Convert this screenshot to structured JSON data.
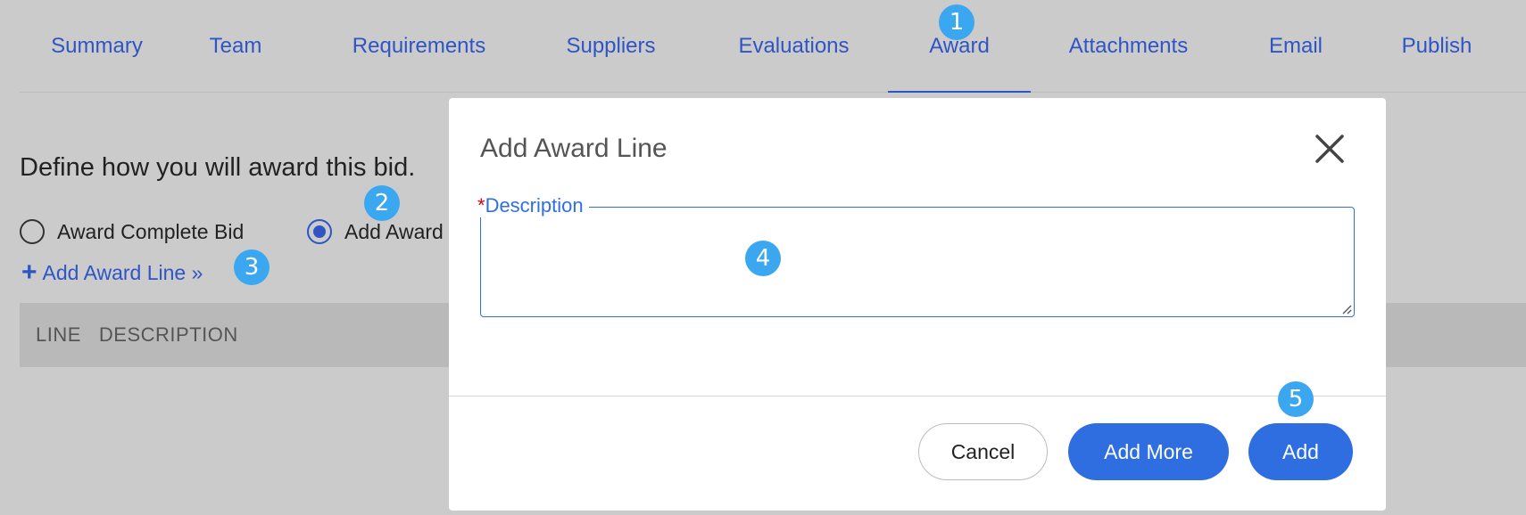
{
  "tabs": [
    {
      "label": "Summary"
    },
    {
      "label": "Team"
    },
    {
      "label": "Requirements"
    },
    {
      "label": "Suppliers"
    },
    {
      "label": "Evaluations"
    },
    {
      "label": "Award",
      "active": true
    },
    {
      "label": "Attachments"
    },
    {
      "label": "Email"
    },
    {
      "label": "Publish"
    }
  ],
  "award": {
    "heading": "Define how you will award this bid.",
    "options": [
      {
        "label": "Award Complete Bid",
        "selected": false
      },
      {
        "label": "Add Award",
        "selected": true
      }
    ],
    "add_line_link": "Add Award Line »",
    "add_line_icon": "plus-icon",
    "table_headers": [
      "LINE",
      "DESCRIPTION"
    ]
  },
  "modal": {
    "title": "Add Award Line",
    "close_icon": "close-icon",
    "description_required_mark": "*",
    "description_label": "Description",
    "description_value": "",
    "buttons": {
      "cancel": "Cancel",
      "add_more": "Add More",
      "add": "Add"
    }
  },
  "badges": [
    "1",
    "2",
    "3",
    "4",
    "5"
  ],
  "colors": {
    "accent": "#2f55c4",
    "primary_button": "#2e6ee0",
    "badge": "#3aa7f0",
    "overlay_background": "#cbcbcb",
    "required": "#d0021b"
  }
}
